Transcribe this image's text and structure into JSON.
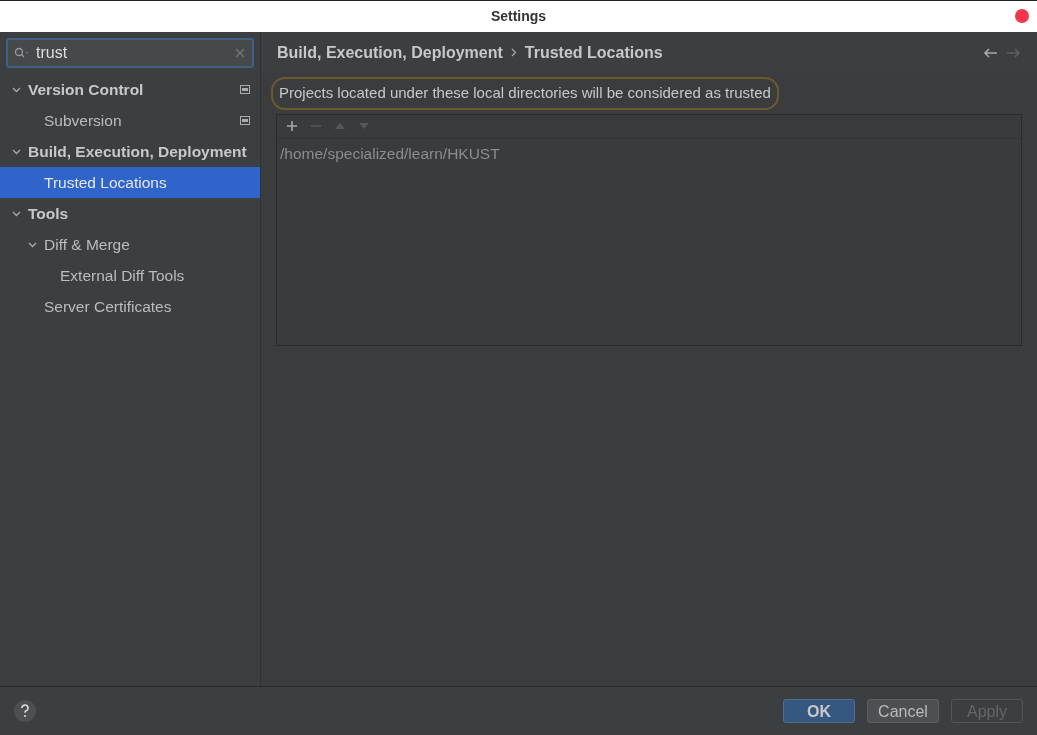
{
  "window": {
    "title": "Settings"
  },
  "search": {
    "value": "trust"
  },
  "tree": [
    {
      "label": "Version Control",
      "expanded": true,
      "project_icon": true,
      "selected": false,
      "children": [
        {
          "label": "Subversion",
          "project_icon": true,
          "selected": false
        }
      ]
    },
    {
      "label": "Build, Execution, Deployment",
      "expanded": true,
      "project_icon": false,
      "selected": false,
      "children": [
        {
          "label": "Trusted Locations",
          "project_icon": false,
          "selected": true
        }
      ]
    },
    {
      "label": "Tools",
      "expanded": true,
      "project_icon": false,
      "selected": false,
      "children": [
        {
          "label": "Diff & Merge",
          "expanded": true,
          "project_icon": false,
          "selected": false,
          "children": [
            {
              "label": "External Diff Tools",
              "project_icon": false,
              "selected": false
            }
          ]
        },
        {
          "label": "Server Certificates",
          "project_icon": false,
          "selected": false
        }
      ]
    }
  ],
  "breadcrumb": [
    "Build, Execution, Deployment",
    "Trusted Locations"
  ],
  "nav": [
    {
      "kind": "back",
      "disabled": false
    },
    {
      "kind": "forward",
      "disabled": true
    }
  ],
  "description": "Projects located under these local directories will be considered as trusted",
  "toolbar": [
    {
      "kind": "add",
      "disabled": false
    },
    {
      "kind": "remove",
      "disabled": true
    },
    {
      "kind": "up",
      "disabled": true
    },
    {
      "kind": "down",
      "disabled": true
    }
  ],
  "locations": [
    "/home/specialized/learn/HKUST"
  ],
  "buttons": [
    {
      "label": "OK",
      "default": true,
      "disabled": false
    },
    {
      "label": "Cancel",
      "default": false,
      "disabled": false
    },
    {
      "label": "Apply",
      "default": false,
      "disabled": true
    }
  ]
}
